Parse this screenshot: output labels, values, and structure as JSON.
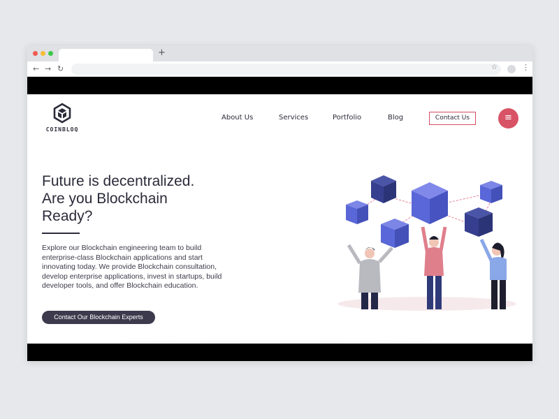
{
  "browser": {
    "url": "",
    "new_tab_icon": "plus-icon",
    "icons": [
      "back-arrow-icon",
      "forward-arrow-icon",
      "reload-icon",
      "star-icon",
      "profile-icon",
      "more-vert-icon"
    ]
  },
  "site": {
    "brand": "COINBLOQ",
    "nav": {
      "about": "About Us",
      "services": "Services",
      "portfolio": "Portfolio",
      "blog": "Blog",
      "contact": "Contact Us"
    },
    "hero": {
      "headline_line1": "Future is decentralized.",
      "headline_line2": "Are you Blockchain",
      "headline_line3": "Ready?",
      "description": "Explore our Blockchain engineering team to build enterprise-class Blockchain applications and start innovating today. We provide Blockchain consultation, develop enterprise applications, invest in startups, build developer tools, and offer Blockchain education.",
      "cta": "Contact Our Blockchain Experts"
    }
  },
  "colors": {
    "accent": "#d85366",
    "dark": "#3d3a4d",
    "cube_light": "#5a67d8",
    "cube_dark": "#363f8f"
  }
}
